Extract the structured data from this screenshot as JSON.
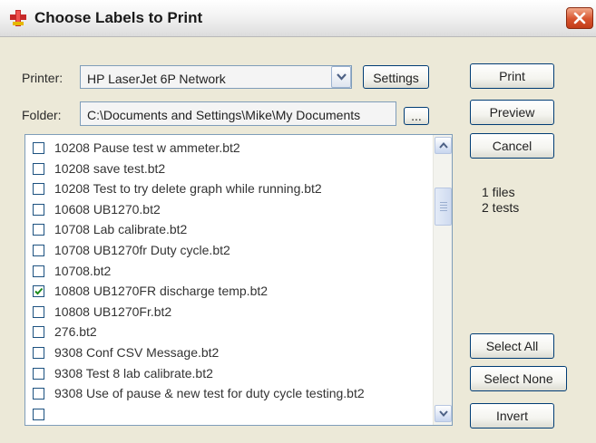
{
  "window": {
    "title": "Choose Labels to Print"
  },
  "icons": {
    "app": "labels-app-icon",
    "close": "close-icon",
    "dropdown": "chevron-down-icon",
    "check": "check-icon"
  },
  "colors": {
    "accent": "#003c74",
    "close": "#d7532e",
    "check": "#1b8a1b"
  },
  "printer": {
    "label": "Printer:",
    "value": "HP LaserJet 6P Network"
  },
  "settings_button": "Settings",
  "folder": {
    "label": "Folder:",
    "value": "C:\\Documents and Settings\\Mike\\My Documents",
    "browse_label": "..."
  },
  "buttons": {
    "print": "Print",
    "preview": "Preview",
    "cancel": "Cancel",
    "select_all": "Select All",
    "select_none": "Select None",
    "invert": "Invert"
  },
  "summary": {
    "files": "1 files",
    "tests": "2 tests"
  },
  "files": [
    {
      "name": "10208 Pause test w ammeter.bt2",
      "checked": false
    },
    {
      "name": "10208 save test.bt2",
      "checked": false
    },
    {
      "name": "10208 Test to try delete graph while running.bt2",
      "checked": false
    },
    {
      "name": "10608 UB1270.bt2",
      "checked": false
    },
    {
      "name": "10708 Lab calibrate.bt2",
      "checked": false
    },
    {
      "name": "10708 UB1270fr Duty cycle.bt2",
      "checked": false
    },
    {
      "name": "10708.bt2",
      "checked": false
    },
    {
      "name": "10808 UB1270FR discharge temp.bt2",
      "checked": true
    },
    {
      "name": "10808 UB1270Fr.bt2",
      "checked": false
    },
    {
      "name": "276.bt2",
      "checked": false
    },
    {
      "name": "9308 Conf CSV Message.bt2",
      "checked": false
    },
    {
      "name": "9308 Test 8 lab calibrate.bt2",
      "checked": false
    },
    {
      "name": "9308 Use of pause & new test for duty cycle testing.bt2",
      "checked": false
    },
    {
      "name": "",
      "checked": false
    }
  ]
}
